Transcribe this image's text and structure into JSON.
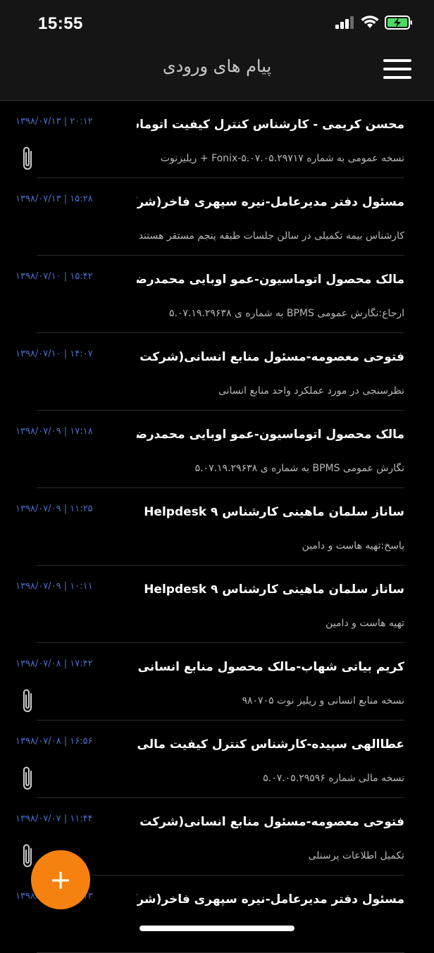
{
  "status_bar": {
    "time": "15:55"
  },
  "header": {
    "title": "پیام های ورودی"
  },
  "messages": [
    {
      "sender": "محسن کریمی - کارشناس کنترل کیفیت اتوماسیون...",
      "subject": "نسخه عمومی به شماره Fonix-۵.۰۷.۰۵.۲۹۷۱۷ + ریلیزنوت",
      "date": "۲۰:۱۲ | ۱۳۹۸/۰۷/۱۳",
      "has_attachment": true
    },
    {
      "sender": "مسئول دفتر مدیرعامل-نیره سپهری فاخر(شرکت برید...",
      "subject": "کارشناس بیمه تکمیلی در سالن جلسات طبقه پنجم مستقر هستند",
      "date": "۱۵:۲۸ | ۱۳۹۸/۰۷/۱۳",
      "has_attachment": false
    },
    {
      "sender": "مالک محصول اتوماسیون-عمو اوبایی محمدرضا(شر...",
      "subject": "ارجاع:نگارش عمومی BPMS به شماره ی ۵.۰۷.۱۹.۲۹۶۳۸",
      "date": "۱۵:۴۲ | ۱۳۹۸/۰۷/۱۰",
      "has_attachment": false
    },
    {
      "sender": "فتوحی معصومه-مسئول منابع انسانی(شرکت برید...",
      "subject": "نظرسنجی در مورد عملکرد واحد منابع انسانی",
      "date": "۱۴:۰۷ | ۱۳۹۸/۰۷/۱۰",
      "has_attachment": false
    },
    {
      "sender": "مالک محصول اتوماسیون-عمو اوبایی محمدرضا(شر...",
      "subject": "نگارش عمومی BPMS به شماره ی ۵.۰۷.۱۹.۲۹۶۳۸",
      "date": "۱۷:۱۸ | ۱۳۹۸/۰۷/۰۹",
      "has_attachment": false
    },
    {
      "sender": "ساناز سلمان ماهینی کارشناس ۹ Helpdesk",
      "subject": "پاسخ:تهیه هاست و دامین",
      "date": "۱۱:۲۵ | ۱۳۹۸/۰۷/۰۹",
      "has_attachment": false
    },
    {
      "sender": "ساناز سلمان ماهینی کارشناس ۹ Helpdesk",
      "subject": "تهیه هاست و دامین",
      "date": "۱۰:۱۱ | ۱۳۹۸/۰۷/۰۹",
      "has_attachment": false
    },
    {
      "sender": "کریم بیاتی شهاب-مالک محصول منابع انسانی(شرک...",
      "subject": "نسخه منابع انسانی و ریلیز نوت ۹۸۰۷۰۵",
      "date": "۱۷:۴۲ | ۱۳۹۸/۰۷/۰۸",
      "has_attachment": true
    },
    {
      "sender": "عطاالهی سپیده-کارشناس کنترل کیفیت مالی(شرکت...",
      "subject": "نسخه مالی شماره ۵.۰۷.۰۵.۲۹۵۹۶",
      "date": "۱۶:۵۶ | ۱۳۹۸/۰۷/۰۸",
      "has_attachment": true
    },
    {
      "sender": "فتوحی معصومه-مسئول منابع انسانی(شرکت برید...",
      "subject": "تکمیل اطلاعات پرسنلی",
      "date": "۱۱:۴۴ | ۱۳۹۸/۰۷/۰۷",
      "has_attachment": true
    },
    {
      "sender": "مسئول دفتر مدیرعامل-نیره سپهری فاخر(شرکت برید...",
      "subject": "",
      "date": "۱۵:۱۳ | ۱۳۹۸/۰۷/۰۶",
      "has_attachment": false
    }
  ],
  "fab": {
    "label": "+"
  },
  "colors": {
    "accent": "#f7810e",
    "date": "#4a6ec8",
    "background": "#000000",
    "header": "#151515"
  },
  "icons": {
    "menu": "hamburger-icon",
    "attachment": "paperclip-icon",
    "signal": "signal-icon",
    "wifi": "wifi-icon",
    "battery": "battery-charging-icon"
  }
}
